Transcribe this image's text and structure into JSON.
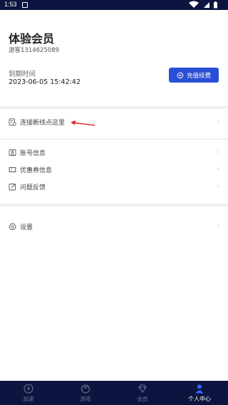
{
  "status_bar": {
    "time": "1:53"
  },
  "profile": {
    "title": "体验会员",
    "user_id": "游客1314625089",
    "expiry_label": "到期时间",
    "expiry_date": "2023-06-05 15:42:42",
    "recharge_label": "充值续费"
  },
  "menu": {
    "reconnect": "连接断线点这里",
    "account": "账号信息",
    "coupon": "优惠券信息",
    "feedback": "问题反馈",
    "settings": "设置",
    "chevron": "›"
  },
  "tabs": [
    {
      "label": "加速",
      "icon": "lightning-icon"
    },
    {
      "label": "游戏",
      "icon": "game-icon"
    },
    {
      "label": "会员",
      "icon": "diamond-icon"
    },
    {
      "label": "个人中心",
      "icon": "person-icon"
    }
  ],
  "colors": {
    "accent": "#2a4fd6",
    "nav_bg": "#0c1540",
    "arrow": "#e02020"
  }
}
